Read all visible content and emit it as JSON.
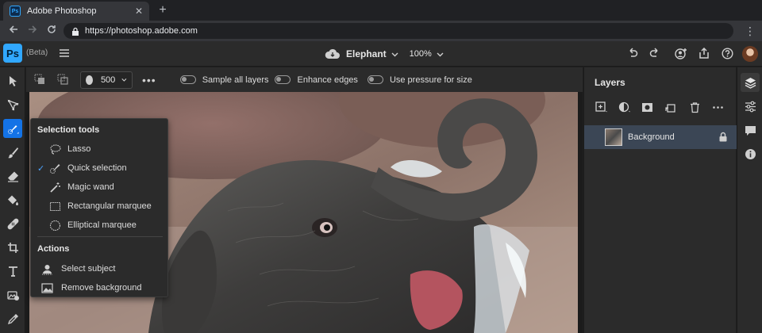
{
  "browser": {
    "tab_title": "Adobe Photoshop",
    "favicon_text": "Ps",
    "url": "https://photoshop.adobe.com"
  },
  "app": {
    "logo_text": "Ps",
    "beta_label": "(Beta)",
    "document_name": "Elephant",
    "zoom_level": "100%"
  },
  "options": {
    "brush_size": "500",
    "toggles": [
      {
        "label": "Sample all layers",
        "on": false
      },
      {
        "label": "Enhance edges",
        "on": false
      },
      {
        "label": "Use pressure for size",
        "on": false
      }
    ]
  },
  "flyout": {
    "selection_heading": "Selection tools",
    "selection_items": [
      {
        "label": "Lasso",
        "icon": "lasso-icon",
        "checked": false
      },
      {
        "label": "Quick selection",
        "icon": "quick-selection-icon",
        "checked": true
      },
      {
        "label": "Magic wand",
        "icon": "magic-wand-icon",
        "checked": false
      },
      {
        "label": "Rectangular marquee",
        "icon": "rectangular-marquee-icon",
        "checked": false
      },
      {
        "label": "Elliptical marquee",
        "icon": "elliptical-marquee-icon",
        "checked": false
      }
    ],
    "actions_heading": "Actions",
    "action_items": [
      {
        "label": "Select subject",
        "icon": "select-subject-icon"
      },
      {
        "label": "Remove background",
        "icon": "remove-background-icon"
      }
    ]
  },
  "layers_panel": {
    "title": "Layers",
    "layers": [
      {
        "name": "Background",
        "locked": true
      }
    ]
  },
  "colors": {
    "accent": "#1473e6",
    "ps_blue": "#31a8ff",
    "selected_layer": "#3b4655",
    "panel_bg": "#2b2b2b"
  }
}
